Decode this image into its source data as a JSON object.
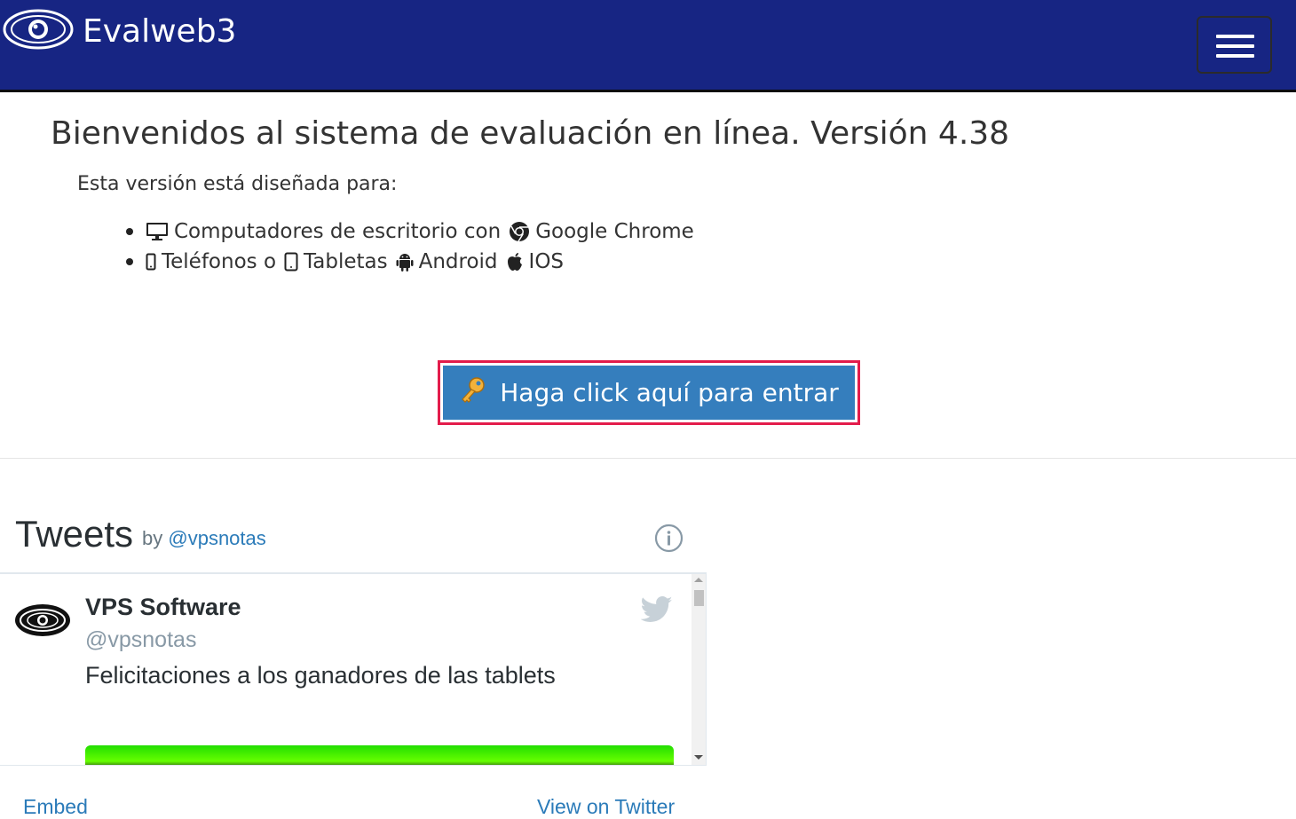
{
  "navbar": {
    "brand": "Evalweb3",
    "logo_icon": "eye-logo-icon",
    "menu_icon": "hamburger-menu-icon",
    "background": "#172583"
  },
  "welcome": {
    "title": "Bienvenidos al sistema de evaluación en línea. Versión 4.38",
    "subtitle": "Esta versión está diseñada para:",
    "features": [
      {
        "text1": "Computadores de escritorio con",
        "text2": "Google Chrome"
      },
      {
        "text1": "Teléfonos o",
        "text2": "Tabletas",
        "text3": "Android",
        "text4": "IOS"
      }
    ]
  },
  "enter_button": {
    "label": "Haga click aquí para entrar",
    "icon": "key-icon",
    "background": "#357ebd",
    "highlight": "#e31c4b"
  },
  "twitter": {
    "title": "Tweets",
    "by": "by",
    "handle_link": "@vpsnotas",
    "tweet": {
      "name": "VPS Software",
      "handle": "@vpsnotas",
      "text": "Felicitaciones a los ganadores de las tablets"
    },
    "embed_link": "Embed",
    "view_link": "View on Twitter"
  }
}
